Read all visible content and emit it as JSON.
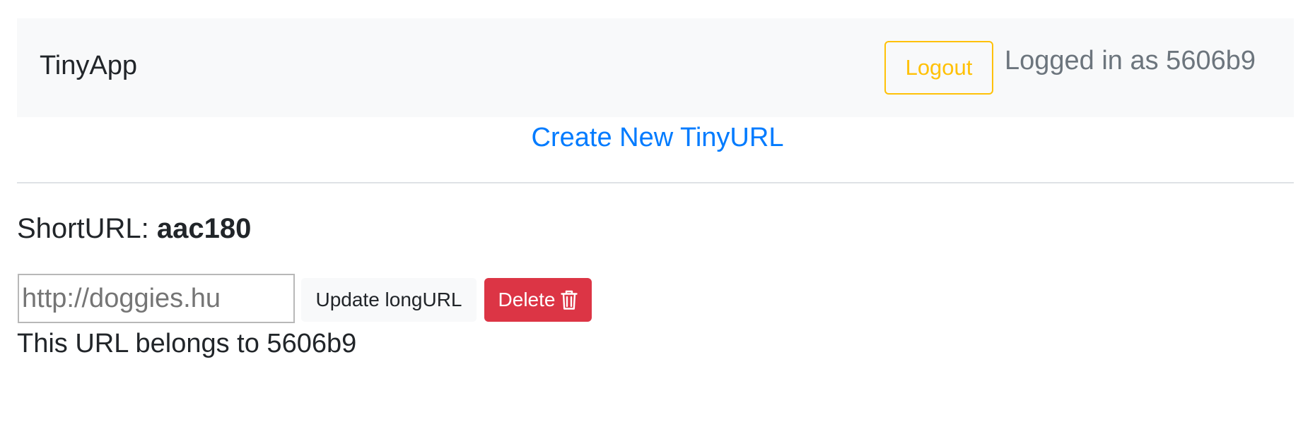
{
  "navbar": {
    "brand": "TinyApp",
    "logout_label": "Logout",
    "logged_in_text": "Logged in as 5606b9"
  },
  "create_link": {
    "label": "Create New TinyURL"
  },
  "short_url": {
    "prefix": "ShortURL: ",
    "id": "aac180"
  },
  "edit_form": {
    "long_url_placeholder": "http://doggies.hu",
    "long_url_value": "",
    "update_label": "Update longURL",
    "delete_label": "Delete",
    "delete_icon": "trash-icon"
  },
  "owner_text": "This URL belongs to 5606b9",
  "colors": {
    "navbar_bg": "#f8f9fa",
    "warning": "#ffc107",
    "link": "#007bff",
    "danger": "#dc3545",
    "muted": "#6c757d"
  }
}
